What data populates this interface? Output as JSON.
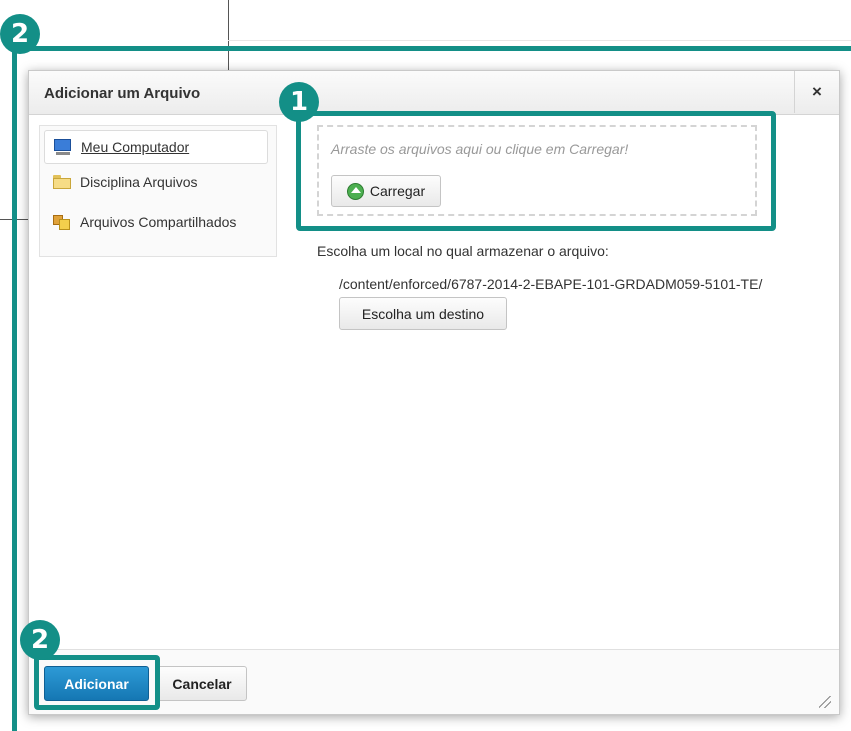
{
  "dialog": {
    "title": "Adicionar um Arquivo",
    "close_label": "×"
  },
  "sidebar": {
    "items": [
      {
        "label": "Meu Computador",
        "icon": "computer-icon",
        "active": true
      },
      {
        "label": "Disciplina Arquivos",
        "icon": "folder-icon",
        "active": false
      },
      {
        "label": "Arquivos Compartilhados",
        "icon": "shared-files-icon",
        "active": false
      }
    ]
  },
  "upload": {
    "drop_hint": "Arraste os arquivos aqui ou clique em Carregar!",
    "upload_button_label": "Carregar"
  },
  "destination": {
    "label": "Escolha um local no qual armazenar o arquivo:",
    "path": "/content/enforced/6787-2014-2-EBAPE-101-GRDADM059-5101-TE/",
    "choose_button_label": "Escolha um destino"
  },
  "footer": {
    "add_button_label": "Adicionar",
    "cancel_button_label": "Cancelar"
  },
  "annotations": {
    "badge_1": "1",
    "badge_2_top": "2",
    "badge_2_bottom": "2",
    "color": "#138f87"
  },
  "colors": {
    "primary_button": "#1577b3",
    "upload_icon": "#4caf50"
  }
}
